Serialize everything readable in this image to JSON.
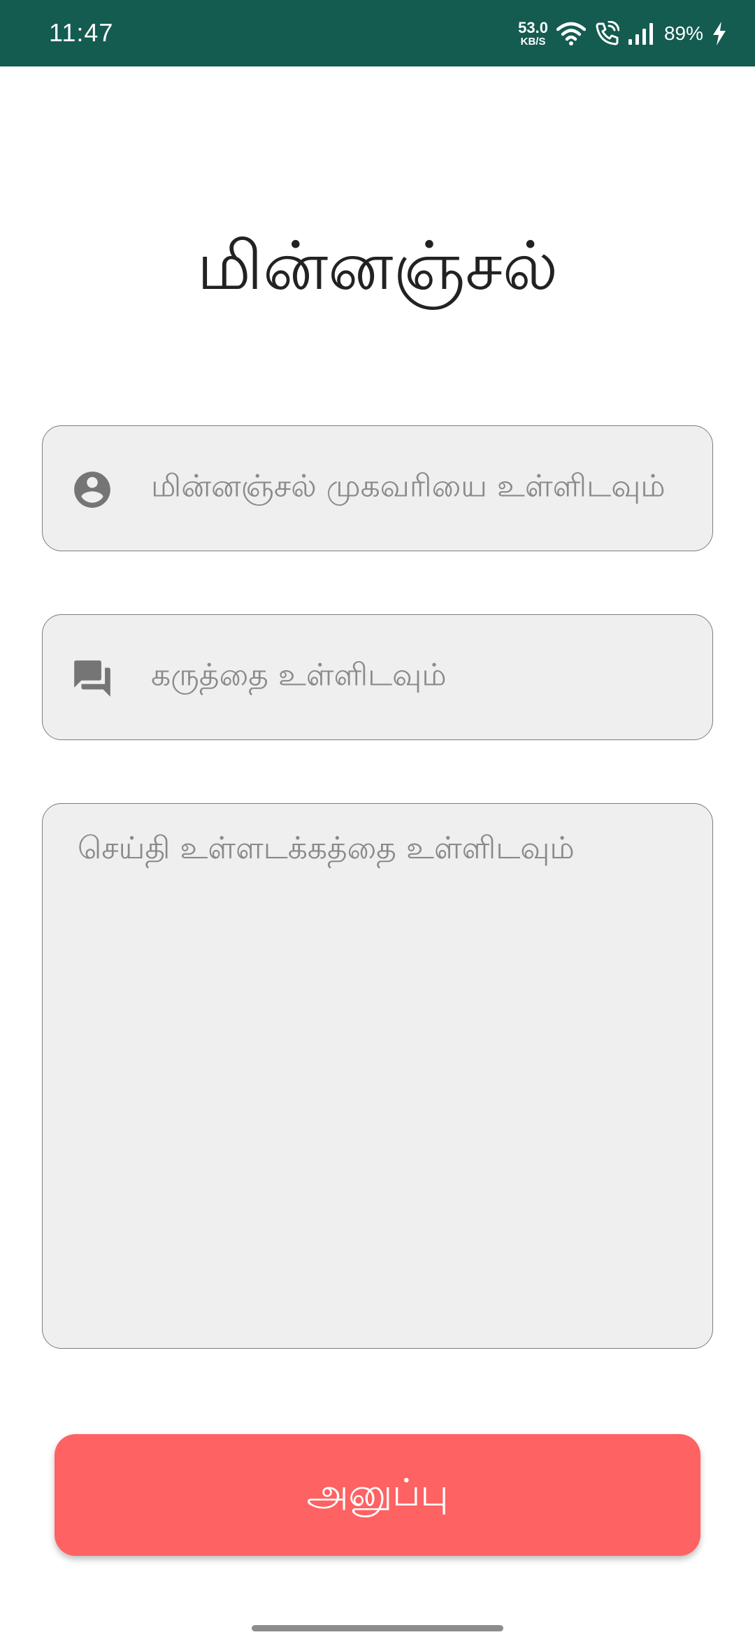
{
  "status_bar": {
    "time": "11:47",
    "net_speed_value": "53.0",
    "net_speed_unit": "KB/S",
    "battery_percent": "89%",
    "background_color": "#145b50",
    "icons": [
      "wifi-icon",
      "wifi-calling-icon",
      "signal-icon",
      "charging-icon"
    ]
  },
  "page": {
    "title": "மின்னஞ்சல்"
  },
  "form": {
    "email_placeholder": "மின்னஞ்சல் முகவரியை உள்ளிடவும்",
    "email_icon": "account-circle-icon",
    "subject_placeholder": "கருத்தை உள்ளிடவும்",
    "subject_icon": "forum-icon",
    "message_placeholder": "செய்தி உள்ளடக்கத்தை உள்ளிடவும்",
    "field_background": "#efefef"
  },
  "actions": {
    "send_label": "அனுப்பு",
    "send_color": "#fe6262"
  }
}
